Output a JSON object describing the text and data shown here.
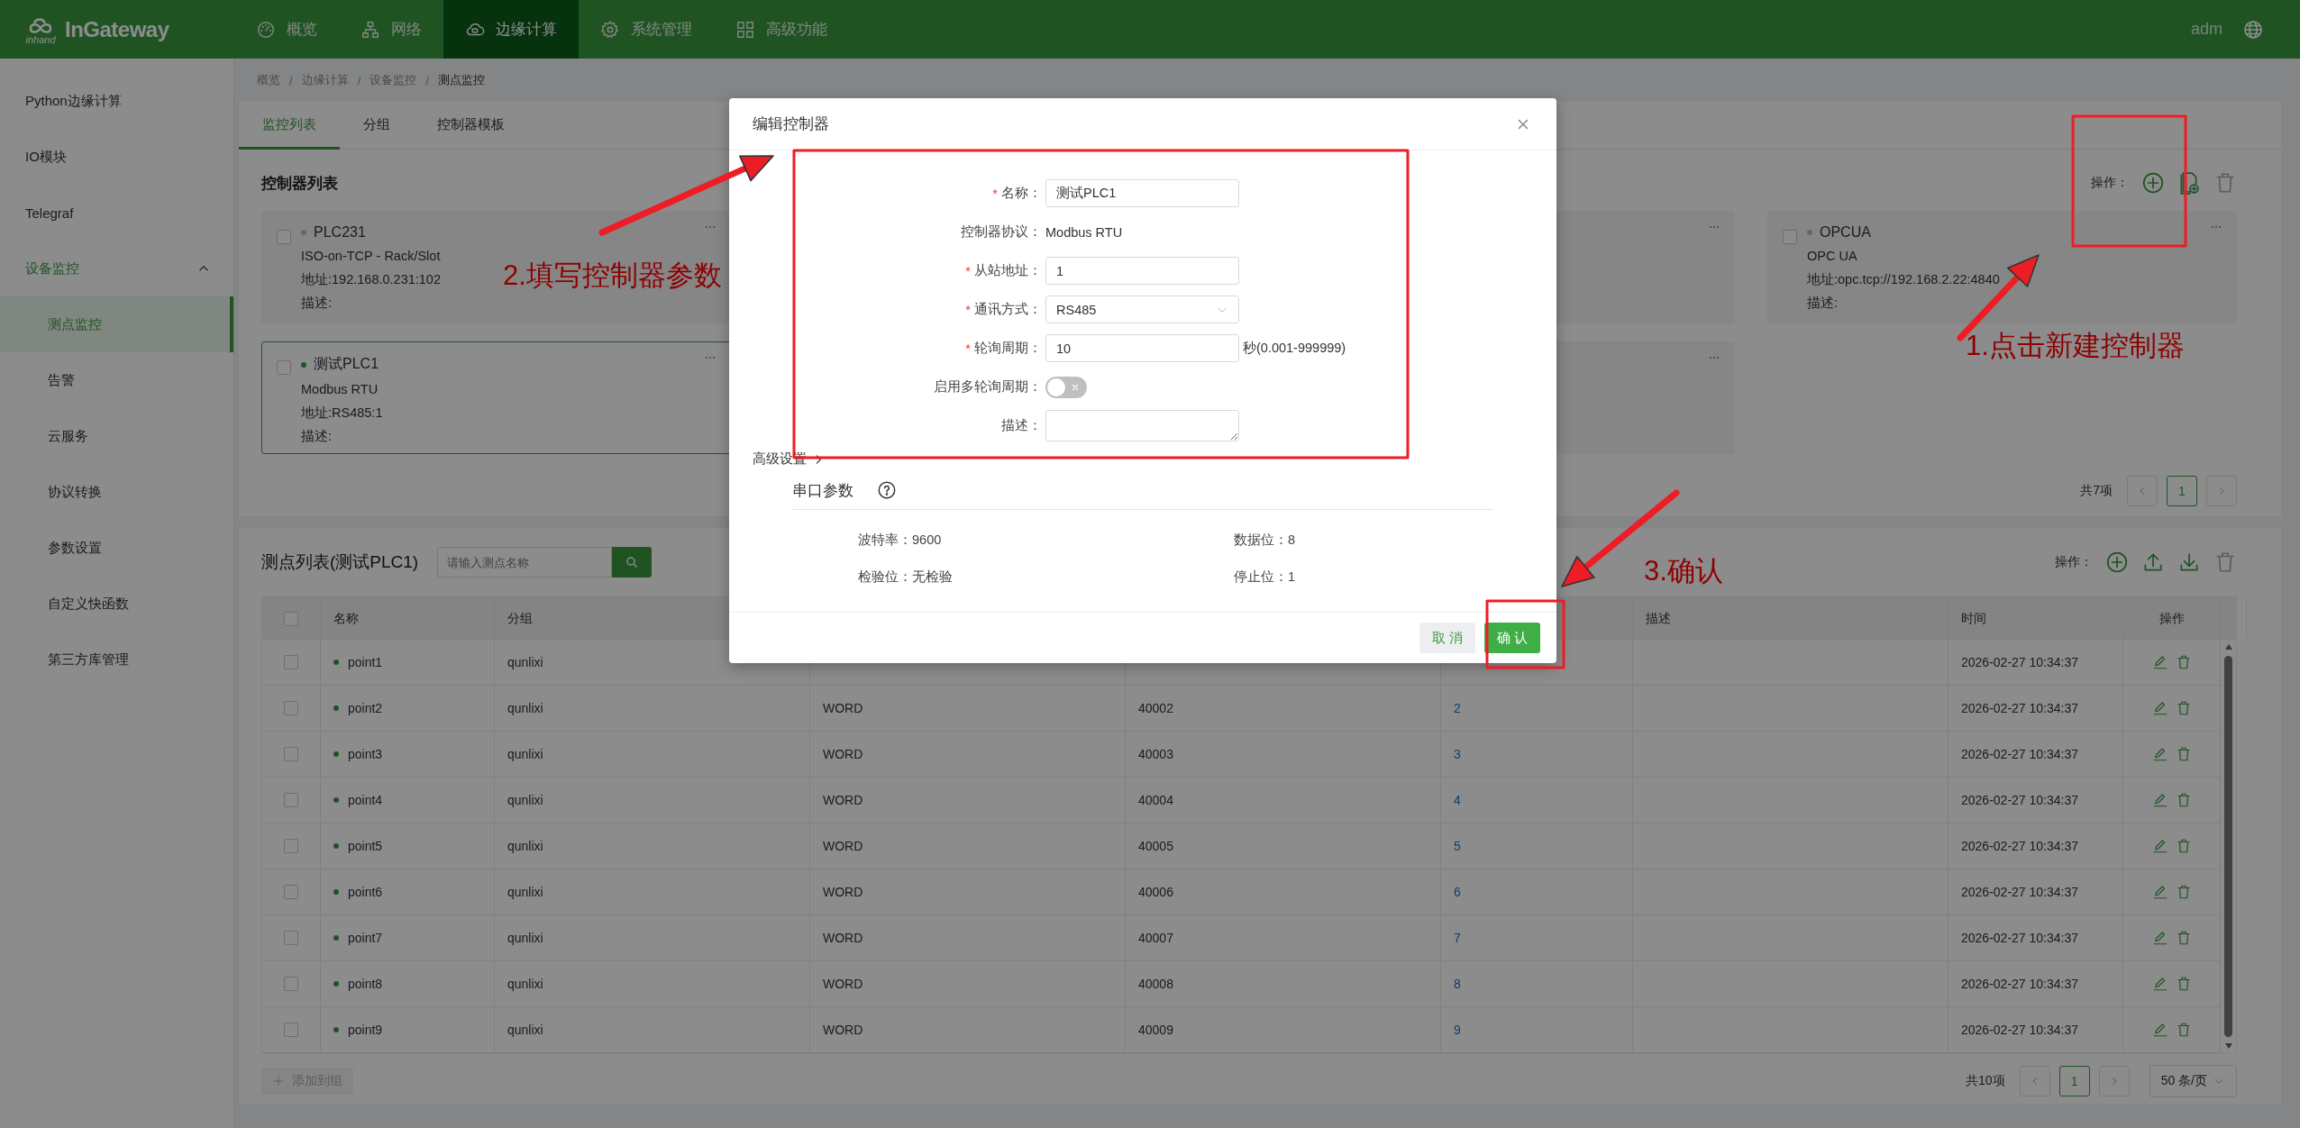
{
  "topbar": {
    "logo_sub": "inhand",
    "logo": "InGateway",
    "nav": [
      {
        "label": "概览",
        "selected": false
      },
      {
        "label": "网络",
        "selected": false
      },
      {
        "label": "边缘计算",
        "selected": true
      },
      {
        "label": "系统管理",
        "selected": false
      },
      {
        "label": "高级功能",
        "selected": false
      }
    ],
    "user": "adm"
  },
  "sidebar": {
    "items": [
      {
        "label": "Python边缘计算",
        "selected": false
      },
      {
        "label": "IO模块",
        "selected": false
      },
      {
        "label": "Telegraf",
        "selected": false
      },
      {
        "label": "设备监控",
        "selected": false,
        "expanded": true,
        "children": [
          {
            "label": "测点监控",
            "selected": true
          },
          {
            "label": "告警",
            "selected": false
          },
          {
            "label": "云服务",
            "selected": false
          },
          {
            "label": "协议转换",
            "selected": false
          },
          {
            "label": "参数设置",
            "selected": false
          },
          {
            "label": "自定义快函数",
            "selected": false
          },
          {
            "label": "第三方库管理",
            "selected": false
          }
        ]
      }
    ]
  },
  "breadcrumb": {
    "separator": "/",
    "items": [
      "概览",
      "边缘计算",
      "设备监控",
      "测点监控"
    ]
  },
  "tabs": [
    {
      "label": "监控列表",
      "selected": true
    },
    {
      "label": "分组",
      "selected": false
    },
    {
      "label": "控制器模板",
      "selected": false
    }
  ],
  "controllers": {
    "title": "控制器列表",
    "actions_label": "操作：",
    "actions": [
      {
        "kind": "add",
        "disabled": false
      },
      {
        "kind": "add-file",
        "disabled": false
      },
      {
        "kind": "delete",
        "disabled": true
      }
    ],
    "cards": [
      {
        "kind": "card",
        "name": "PLC231",
        "online": false,
        "checked": false,
        "selected": false,
        "protocol": "ISO-on-TCP - Rack/Slot",
        "address": "地址:192.168.0.231:102",
        "description": "描述:"
      },
      {
        "kind": "covered",
        "selected": false
      },
      {
        "kind": "card",
        "name": "OPCUA",
        "online": false,
        "checked": false,
        "selected": false,
        "protocol": "OPC UA",
        "address": "地址:opc.tcp://192.168.2.22:4840",
        "description": "描述:"
      },
      {
        "kind": "card",
        "name": "测试PLC1",
        "online": true,
        "checked": false,
        "selected": true,
        "protocol": "Modbus RTU",
        "address": "地址:RS485:1",
        "description": "描述:"
      },
      {
        "kind": "covered",
        "selected": false
      }
    ],
    "pagination": {
      "total": "共7项",
      "pages": [
        {
          "label": "1",
          "selected": true
        }
      ]
    }
  },
  "points": {
    "title": "测点列表(测试PLC1)",
    "search": {
      "placeholder": "请输入测点名称"
    },
    "actions_label": "操作：",
    "actions": [
      {
        "kind": "add",
        "disabled": false
      },
      {
        "kind": "upload",
        "disabled": false
      },
      {
        "kind": "download",
        "disabled": false
      },
      {
        "kind": "delete",
        "disabled": true
      }
    ],
    "select_all_checked": false,
    "columns": [
      "名称",
      "分组",
      "描述",
      "时间",
      "操作"
    ],
    "rows": [
      {
        "checked": false,
        "online": true,
        "name": "point1",
        "group": "qunlixi",
        "time": "2026-02-27 10:34:37"
      },
      {
        "checked": false,
        "online": true,
        "name": "point2",
        "group": "qunlixi",
        "column_3": "WORD",
        "column_4": "40002",
        "column_5": "2",
        "time": "2026-02-27 10:34:37"
      },
      {
        "checked": false,
        "online": true,
        "name": "point3",
        "group": "qunlixi",
        "column_3": "WORD",
        "column_4": "40003",
        "column_5": "3",
        "time": "2026-02-27 10:34:37"
      },
      {
        "checked": false,
        "online": true,
        "name": "point4",
        "group": "qunlixi",
        "column_3": "WORD",
        "column_4": "40004",
        "column_5": "4",
        "time": "2026-02-27 10:34:37"
      },
      {
        "checked": false,
        "online": true,
        "name": "point5",
        "group": "qunlixi",
        "column_3": "WORD",
        "column_4": "40005",
        "column_5": "5",
        "time": "2026-02-27 10:34:37"
      },
      {
        "checked": false,
        "online": true,
        "name": "point6",
        "group": "qunlixi",
        "column_3": "WORD",
        "column_4": "40006",
        "column_5": "6",
        "time": "2026-02-27 10:34:37"
      },
      {
        "checked": false,
        "online": true,
        "name": "point7",
        "group": "qunlixi",
        "column_3": "WORD",
        "column_4": "40007",
        "column_5": "7",
        "time": "2026-02-27 10:34:37"
      },
      {
        "checked": false,
        "online": true,
        "name": "point8",
        "group": "qunlixi",
        "column_3": "WORD",
        "column_4": "40008",
        "column_5": "8",
        "time": "2026-02-27 10:34:37"
      },
      {
        "checked": false,
        "online": true,
        "name": "point9",
        "group": "qunlixi",
        "column_3": "WORD",
        "column_4": "40009",
        "column_5": "9",
        "time": "2026-02-27 10:34:37"
      }
    ],
    "add_to_group": "添加到组",
    "total": "共10项",
    "pages": [
      {
        "label": "1",
        "selected": true
      }
    ],
    "page_size": "50 条/页"
  },
  "modal": {
    "title": "编辑控制器",
    "required_mark": "*",
    "fields": [
      {
        "kind": "input",
        "required": true,
        "label": "名称：",
        "value": "测试PLC1"
      },
      {
        "kind": "text",
        "required": false,
        "label": "控制器协议：",
        "value": "Modbus RTU"
      },
      {
        "kind": "input",
        "required": true,
        "label": "从站地址：",
        "value": "1"
      },
      {
        "kind": "select",
        "required": true,
        "label": "通讯方式：",
        "value": "RS485"
      },
      {
        "kind": "input",
        "required": true,
        "label": "轮询周期：",
        "value": "10",
        "suffix": "秒(0.001-999999)"
      },
      {
        "kind": "switch",
        "required": false,
        "label": "启用多轮询周期：",
        "on": false
      },
      {
        "kind": "textarea",
        "required": false,
        "label": "描述："
      }
    ],
    "advanced": "高级设置",
    "serial_title": "串口参数",
    "serial_params": [
      "波特率：9600",
      "数据位：8",
      "检验位：无检验",
      "停止位：1"
    ],
    "buttons": [
      {
        "kind": "cancel",
        "label": "取 消"
      },
      {
        "kind": "primary",
        "label": "确 认"
      }
    ]
  },
  "annotations": [
    "2.填写控制器参数",
    "1.点击新建控制器",
    "3.确认"
  ]
}
